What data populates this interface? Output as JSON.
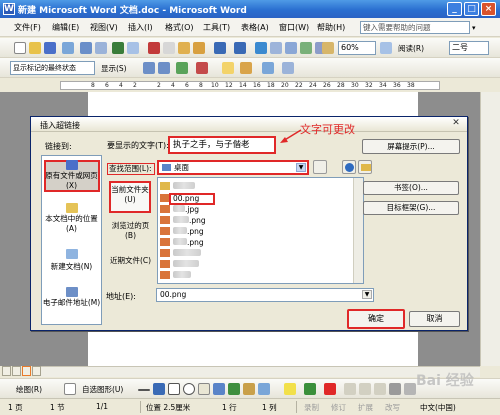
{
  "window": {
    "title": "新建 Microsoft Word 文档.doc - Microsoft Word"
  },
  "menubar": {
    "items": [
      "文件(F)",
      "编辑(E)",
      "视图(V)",
      "插入(I)",
      "格式(O)",
      "工具(T)",
      "表格(A)",
      "窗口(W)",
      "帮助(H)"
    ],
    "help_placeholder": "键入需要帮助的问题"
  },
  "toolbar": {
    "zoom": "60%",
    "read_label": "阅读(R)",
    "font_size": "二号"
  },
  "reviewbar": {
    "markup_state": "显示标记的最终状态",
    "show_label": "显示(S)"
  },
  "ruler": {
    "numbers": [
      "8",
      "6",
      "4",
      "2",
      "2",
      "4",
      "6",
      "8",
      "10",
      "12",
      "14",
      "16",
      "18",
      "20",
      "22",
      "24",
      "26",
      "28",
      "30",
      "32",
      "34",
      "36",
      "38"
    ]
  },
  "dialog": {
    "title": "插入超链接",
    "link_to_label": "链接到:",
    "link_to_items": [
      "原有文件或网页(X)",
      "本文档中的位置(A)",
      "新建文档(N)",
      "电子邮件地址(M)"
    ],
    "display_text_label": "要显示的文字(T):",
    "display_text_value": "执子之手，与子偕老",
    "annotation": "文字可更改",
    "screentip_button": "屏幕提示(P)...",
    "look_in_label": "查找范围(L):",
    "look_in_value": "桌面",
    "places": [
      "当前文件夹(U)",
      "浏览过的页(B)",
      "近期文件(C)"
    ],
    "files": [
      ".png",
      "00.png",
      ".jpg",
      ".png",
      ".png",
      ".png",
      ".png",
      ".png"
    ],
    "bookmark_button": "书签(O)...",
    "target_frame_button": "目标框架(G)...",
    "address_label": "地址(E):",
    "address_value": "00.png",
    "ok_button": "确定",
    "cancel_button": "取消"
  },
  "drawbar": {
    "draw_label": "绘图(R)",
    "autoshapes_label": "自选图形(U)"
  },
  "statusbar": {
    "page": "1 页",
    "section": "1 节",
    "page_of": "1/1",
    "position": "位置 2.5厘米",
    "line": "1 行",
    "column": "1 列",
    "rec": "录制",
    "trk": "修订",
    "ext": "扩展",
    "ovr": "改写",
    "lang": "中文(中国)"
  },
  "watermark": "Bai 经验"
}
